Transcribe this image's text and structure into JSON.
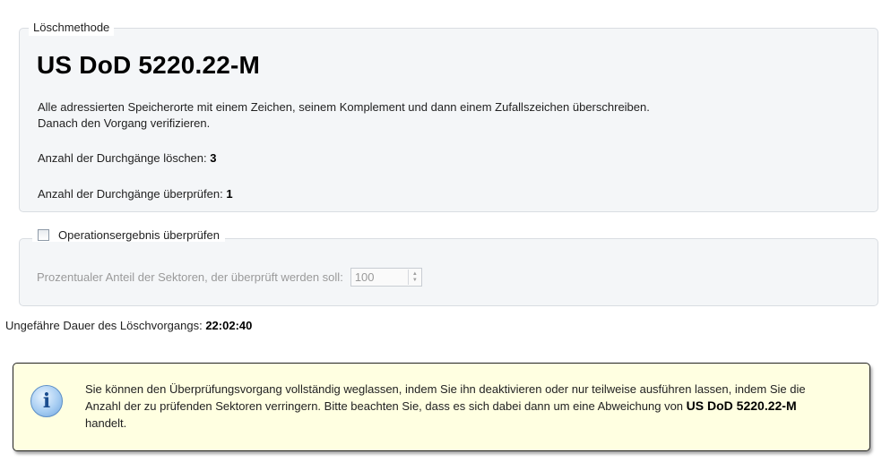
{
  "method_group": {
    "legend": "Löschmethode",
    "title": "US DoD 5220.22-M",
    "description_line1": "Alle adressierten Speicherorte mit einem Zeichen, seinem Komplement und dann einem Zufallszeichen überschreiben.",
    "description_line2": "Danach den Vorgang verifizieren.",
    "passes_delete_label": "Anzahl der Durchgänge löschen:",
    "passes_delete_value": "3",
    "passes_verify_label": "Anzahl der Durchgänge überprüfen:",
    "passes_verify_value": "1"
  },
  "verify_group": {
    "checkbox_label": "Operationsergebnis überprüfen",
    "checked": false,
    "sectors_label": "Prozentualer Anteil der Sektoren, der überprüft werden soll:",
    "sectors_value": "100"
  },
  "duration": {
    "label": "Ungefähre Dauer des Löschvorgangs:",
    "value": "22:02:40"
  },
  "info": {
    "text_part1": "Sie können den Überprüfungsvorgang vollständig weglassen, indem Sie ihn deaktivieren oder nur teilweise ausführen lassen, indem Sie die Anzahl der zu prüfenden Sektoren verringern. Bitte beachten Sie, dass es sich dabei dann um eine Abweichung von",
    "text_bold": "US DoD 5220.22-M",
    "text_part2": "handelt.",
    "icon": "info-icon"
  }
}
